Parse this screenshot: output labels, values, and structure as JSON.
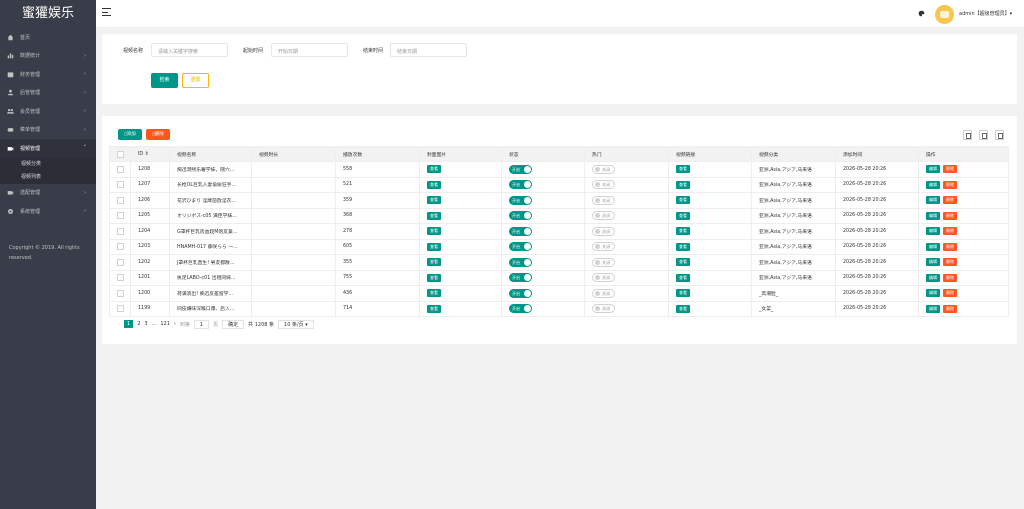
{
  "app": {
    "title": "蜜獾娱乐"
  },
  "sidebar": {
    "items": [
      {
        "label": "首页",
        "icon": "home-icon"
      },
      {
        "label": "数据统计",
        "icon": "bar-chart-icon"
      },
      {
        "label": "财务管理",
        "icon": "wallet-icon"
      },
      {
        "label": "后管管理",
        "icon": "user-icon"
      },
      {
        "label": "会员管理",
        "icon": "users-icon"
      },
      {
        "label": "菜单管理",
        "icon": "menu-icon"
      },
      {
        "label": "视频管理",
        "icon": "video-icon"
      },
      {
        "label": "选配管理",
        "icon": "video-icon"
      },
      {
        "label": "系统管理",
        "icon": "gear-icon"
      }
    ],
    "sub_items": [
      "视频分类",
      "视频列表"
    ],
    "copyright": "Copyright © 2019. All rights reserved."
  },
  "header": {
    "user": "admin【超级管理员】▾"
  },
  "search": {
    "name_label": "视频名称",
    "name_placeholder": "请输入关键字搜索",
    "start_label": "起始时间",
    "start_placeholder": "开始日期",
    "end_label": "结束时间",
    "end_placeholder": "结束日期",
    "search_btn": "检索",
    "reset_btn": "重置"
  },
  "toolbar": {
    "add": "添加",
    "delete": "删除"
  },
  "table": {
    "headers": [
      "ID ⇕",
      "视频名称",
      "视频时长",
      "播放次数",
      "封面图片",
      "状态",
      "热门",
      "视频链接",
      "视频分类",
      "添加时间",
      "操作"
    ],
    "view_label": "查看",
    "on_label": "开启",
    "off_label": "关闭",
    "edit_label": "编辑",
    "remove_label": "删除",
    "rows": [
      {
        "id": "1208",
        "name": "痴迅洞熙乐奢学妹，随穴...",
        "plays": "558",
        "hot": false,
        "category": "亚洲,Asia,アジア,马来语",
        "time": "2026-05-28 20:26"
      },
      {
        "id": "1207",
        "name": "长枪OL巨乳人妻倫偸狂手...",
        "plays": "521",
        "hot": false,
        "category": "亚洲,Asia,アジア,马来语",
        "time": "2026-05-28 20:26"
      },
      {
        "id": "1206",
        "name": "花沢ひまり 淫靡茵放淫衣...",
        "plays": "359",
        "hot": false,
        "category": "亚洲,Asia,アジア,马来语",
        "time": "2026-05-28 20:26"
      },
      {
        "id": "1205",
        "name": "オリジボス-c05 满侄学妹...",
        "plays": "368",
        "hot": false,
        "category": "亚洲,Asia,アジア,马来语",
        "time": "2026-05-28 20:26"
      },
      {
        "id": "1204",
        "name": "G罩杯巨乳房血超M炮友兼...",
        "plays": "278",
        "hot": false,
        "category": "亚洲,Asia,アジア,马来语",
        "time": "2026-05-28 20:26"
      },
      {
        "id": "1203",
        "name": "HNAMH-017 藤咲らら 一...",
        "plays": "605",
        "hot": false,
        "category": "亚洲,Asia,アジア,马来语",
        "time": "2026-05-28 20:26"
      },
      {
        "id": "1202",
        "name": "J罩杯巨乳直生! 男友都散...",
        "plays": "355",
        "hot": false,
        "category": "亚洲,Asia,アジア,马来语",
        "time": "2026-05-28 20:26"
      },
      {
        "id": "1201",
        "name": "执足LABO-c01 出租同嫁...",
        "plays": "755",
        "hot": false,
        "category": "亚洲,Asia,アジア,马来语",
        "time": "2026-05-28 20:26"
      },
      {
        "id": "1200",
        "name": "荷满浪出! 痴迅反差留学...",
        "plays": "436",
        "hot": false,
        "category": "_高潮脸_",
        "time": "2026-05-28 20:26"
      },
      {
        "id": "1199",
        "name": "同伎嫌味深喉口爆、后入...",
        "plays": "714",
        "hot": false,
        "category": "_女菜_",
        "time": "2026-05-28 20:26"
      }
    ]
  },
  "pagination": {
    "prev": "‹",
    "current": "1",
    "p2": "2",
    "p3": "3",
    "ellipsis": "...",
    "last": "121",
    "next": "›",
    "goto_label": "到第",
    "goto_value": "1",
    "page_unit": "页",
    "confirm": "确定",
    "total": "共 1208 条",
    "per_page": "10 条/页 ▾"
  }
}
